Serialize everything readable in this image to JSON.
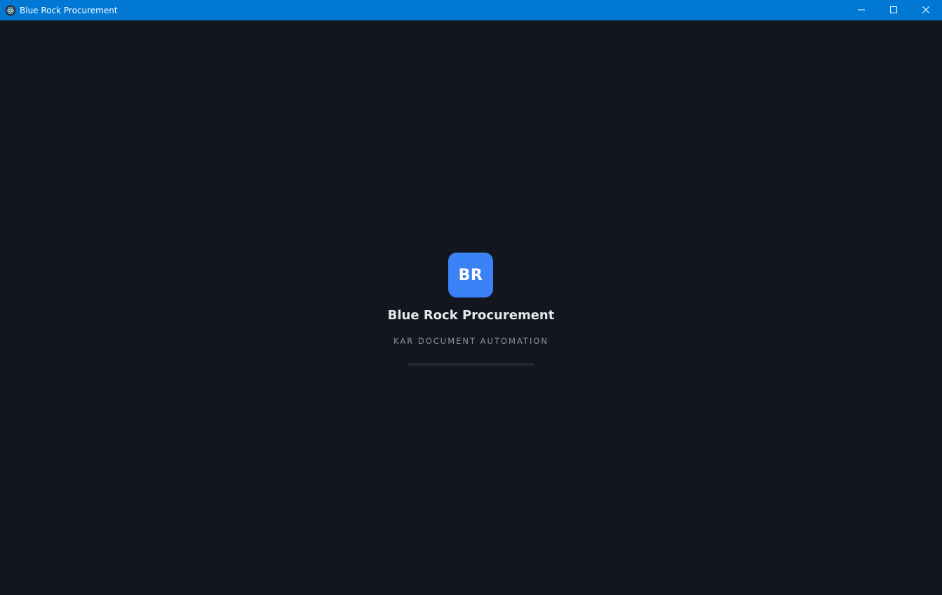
{
  "window": {
    "title": "Blue Rock Procurement",
    "icon": "electron-atom-icon",
    "controls": [
      "minimize-icon",
      "maximize-icon",
      "close-icon"
    ]
  },
  "splash": {
    "logo_text": "BR",
    "app_name": "Blue Rock Procurement",
    "tagline": "KAR DOCUMENT AUTOMATION",
    "progress": 0
  },
  "colors": {
    "titlebar": "#0078d4",
    "background": "#13161e",
    "accent": "#3b82f6",
    "heading": "#e5e7eb",
    "muted": "#8b929e",
    "track": "#262a33"
  }
}
